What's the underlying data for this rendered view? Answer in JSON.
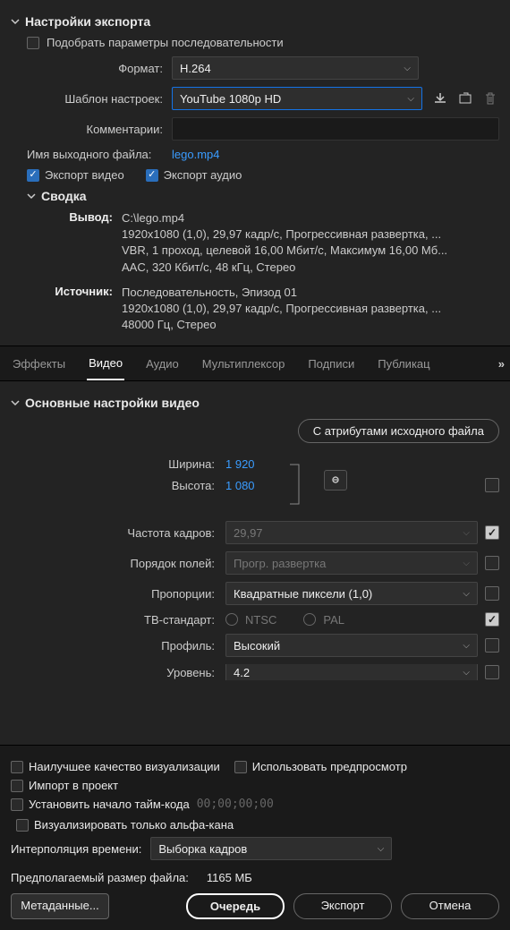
{
  "export_settings": {
    "title": "Настройки экспорта",
    "match_sequence": "Подобрать параметры последовательности",
    "format_label": "Формат:",
    "format_value": "H.264",
    "preset_label": "Шаблон настроек:",
    "preset_value": "YouTube 1080p HD",
    "comments_label": "Комментарии:",
    "output_name_label": "Имя выходного файла:",
    "output_name_value": "lego.mp4",
    "export_video": "Экспорт видео",
    "export_audio": "Экспорт аудио"
  },
  "summary": {
    "title": "Сводка",
    "output_label": "Вывод:",
    "output_path": "C:\\lego.mp4",
    "output_line2": "1920x1080 (1,0), 29,97 кадр/с, Прогрессивная развертка, ...",
    "output_line3": "VBR, 1 проход, целевой 16,00 Мбит/с, Максимум 16,00 Мб...",
    "output_line4": "AAC, 320 Кбит/с, 48 кГц, Стерео",
    "source_label": "Источник:",
    "source_line1": "Последовательность, Эпизод 01",
    "source_line2": "1920x1080 (1,0), 29,97 кадр/с, Прогрессивная развертка, ...",
    "source_line3": "48000 Гц, Стерео"
  },
  "tabs": {
    "effects": "Эффекты",
    "video": "Видео",
    "audio": "Аудио",
    "muxer": "Мультиплексор",
    "captions": "Подписи",
    "publish": "Публикац"
  },
  "video": {
    "section_title": "Основные настройки видео",
    "source_attrs_btn": "С атрибутами исходного файла",
    "width_label": "Ширина:",
    "width_value": "1 920",
    "height_label": "Высота:",
    "height_value": "1 080",
    "fps_label": "Частота кадров:",
    "fps_value": "29,97",
    "field_order_label": "Порядок полей:",
    "field_order_value": "Прогр. развертка",
    "aspect_label": "Пропорции:",
    "aspect_value": "Квадратные пиксели (1,0)",
    "tv_standard_label": "ТВ-стандарт:",
    "ntsc": "NTSC",
    "pal": "PAL",
    "profile_label": "Профиль:",
    "profile_value": "Высокий",
    "level_label": "Уровень:",
    "level_value": "4.2"
  },
  "bottom": {
    "best_quality": "Наилучшее качество визуализации",
    "use_preview": "Использовать предпросмотр",
    "import_project": "Импорт в проект",
    "set_timecode": "Установить начало тайм-кода",
    "timecode": "00;00;00;00",
    "alpha_only": "Визуализировать только альфа-кана",
    "time_interp_label": "Интерполяция времени:",
    "time_interp_value": "Выборка кадров",
    "est_size_label": "Предполагаемый размер файла:",
    "est_size_value": "1165 МБ",
    "metadata_btn": "Метаданные...",
    "queue_btn": "Очередь",
    "export_btn": "Экспорт",
    "cancel_btn": "Отмена"
  }
}
